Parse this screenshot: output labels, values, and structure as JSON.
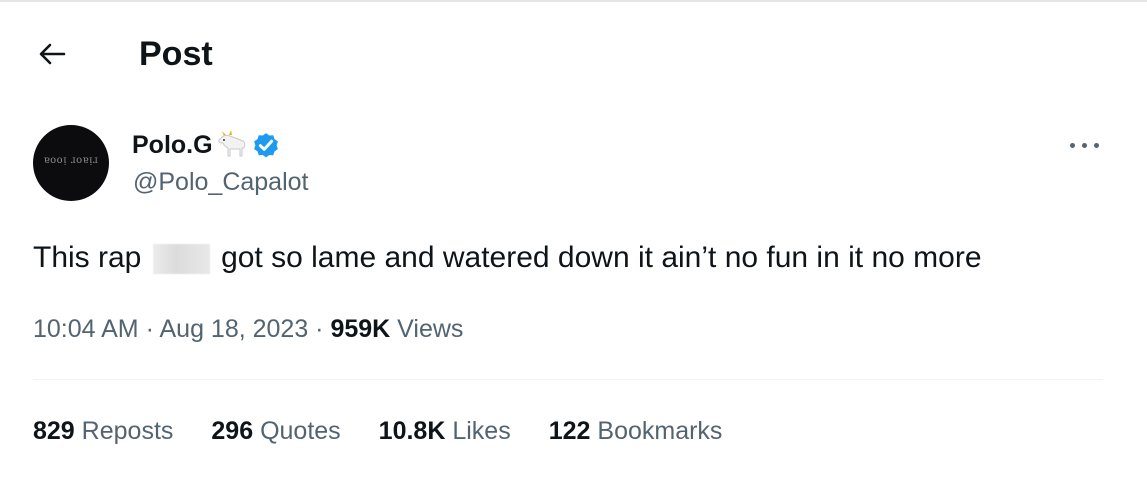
{
  "header": {
    "title": "Post"
  },
  "author": {
    "name": "Polo.G",
    "handle": "@Polo_Capalot",
    "avatar_text": "ɐooᴉ ɹoɐᴉɹ"
  },
  "tweet": {
    "text_before": "This rap",
    "text_after": "got so lame and watered down it ain’t no fun in it no more"
  },
  "meta": {
    "time": "10:04 AM",
    "sep1": " · ",
    "date": "Aug 18, 2023",
    "sep2": " · ",
    "views_count": "959K",
    "views_label": "Views"
  },
  "stats": [
    {
      "count": "829",
      "label": "Reposts"
    },
    {
      "count": "296",
      "label": "Quotes"
    },
    {
      "count": "10.8K",
      "label": "Likes"
    },
    {
      "count": "122",
      "label": "Bookmarks"
    }
  ],
  "colors": {
    "text": "#0f1419",
    "secondary": "#536471",
    "verified": "#1d9bf0",
    "divider": "#eff3f4"
  },
  "icons": {
    "back": "arrow-left-icon",
    "verified": "verified-badge-icon",
    "more": "more-icon",
    "emoji": "goat-emoji-icon"
  }
}
